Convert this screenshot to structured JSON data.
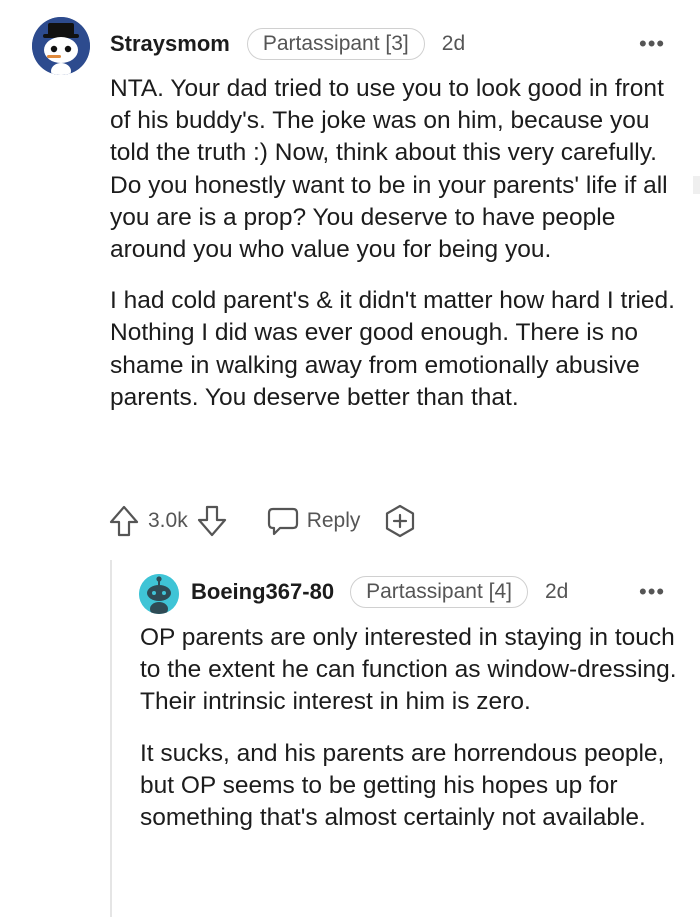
{
  "comments": [
    {
      "username": "Straysmom",
      "flair": "Partassipant [3]",
      "age": "2d",
      "more_label": "•••",
      "paragraphs": [
        "NTA. Your dad tried to use you to look good in front of his buddy's. The joke was on him, because you told the truth :) Now, think about this very carefully. Do you honestly want to be in your parents' life if all you are is a prop? You deserve to have people around you who value you for being you.",
        "I had cold parent's & it didn't matter how hard I tried. Nothing I did was ever good enough. There is no shame in walking away from emotionally abusive parents. You deserve better than that."
      ],
      "upvotes": "3.0k",
      "reply_label": "Reply",
      "avatar_icon": "snoo-avatar-icon"
    },
    {
      "username": "Boeing367-80",
      "flair": "Partassipant [4]",
      "age": "2d",
      "more_label": "•••",
      "paragraphs": [
        "OP parents are only interested in staying in touch to the extent he can function as window-dressing. Their intrinsic interest in him is zero.",
        "It sucks, and his parents are horrendous people, but OP seems to be getting his hopes up for something that's almost certainly not available."
      ],
      "avatar_icon": "snoo-avatar-icon"
    }
  ],
  "colors": {
    "text": "#1c1c1c",
    "meta": "#555555",
    "flair_border": "#d0d0d0",
    "avatar2_bg": "#3fc4d6",
    "avatar1_bg": "#2d4b8e"
  }
}
